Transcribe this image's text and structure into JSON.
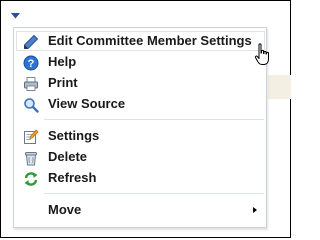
{
  "menu": {
    "items": [
      {
        "label": "Edit Committee Member Settings",
        "icon": "pencil-icon"
      },
      {
        "label": "Help",
        "icon": "help-icon"
      },
      {
        "label": "Print",
        "icon": "printer-icon"
      },
      {
        "label": "View Source",
        "icon": "magnifier-icon"
      },
      {
        "label": "Settings",
        "icon": "settings-icon"
      },
      {
        "label": "Delete",
        "icon": "trash-icon"
      },
      {
        "label": "Refresh",
        "icon": "refresh-icon"
      },
      {
        "label": "Move",
        "icon": "submenu-arrow-icon"
      }
    ]
  },
  "colors": {
    "trigger_arrow": "#2a4f93",
    "menu_border": "#c9d3dc",
    "separator": "#dde3e8"
  }
}
